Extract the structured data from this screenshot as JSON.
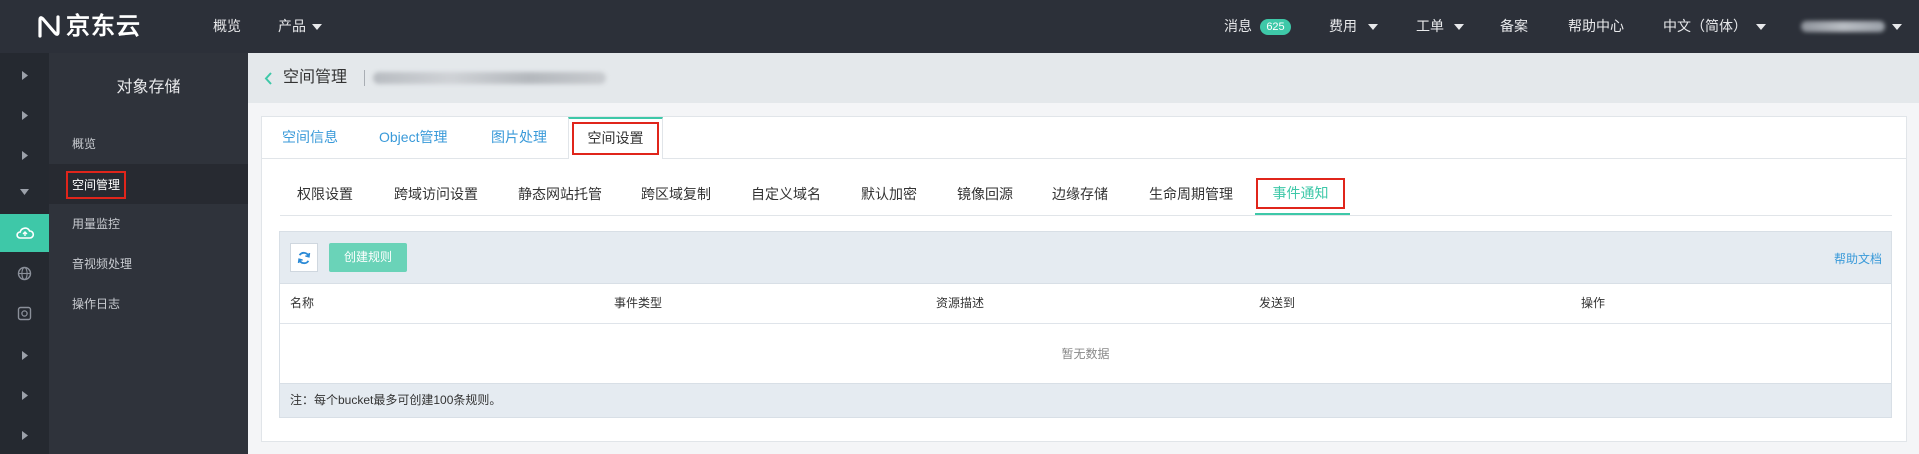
{
  "topnav": {
    "logo_text": "京东云",
    "left_items": [
      {
        "label": "概览"
      },
      {
        "label": "产品"
      }
    ],
    "messages": {
      "label": "消息",
      "count": "625"
    },
    "right_items": [
      {
        "label": "费用"
      },
      {
        "label": "工单"
      },
      {
        "label": "备案"
      },
      {
        "label": "帮助中心"
      },
      {
        "label": "中文（简体）"
      }
    ]
  },
  "rail": {
    "items": [
      {
        "icon": "chevron-right-icon"
      },
      {
        "icon": "chevron-right-icon"
      },
      {
        "icon": "chevron-right-icon"
      },
      {
        "icon": "chevron-down-icon"
      },
      {
        "icon": "cloud-storage-icon",
        "active": true
      },
      {
        "icon": "globe-icon"
      },
      {
        "icon": "container-icon"
      },
      {
        "icon": "chevron-right-icon"
      },
      {
        "icon": "chevron-right-icon"
      },
      {
        "icon": "chevron-right-icon"
      }
    ]
  },
  "sidebar": {
    "title": "对象存储",
    "items": [
      {
        "label": "概览"
      },
      {
        "label": "空间管理",
        "active": true
      },
      {
        "label": "用量监控"
      },
      {
        "label": "音视频处理"
      },
      {
        "label": "操作日志"
      }
    ]
  },
  "header": {
    "title": "空间管理"
  },
  "tabs": {
    "items": [
      "空间信息",
      "Object管理",
      "图片处理",
      "空间设置"
    ],
    "active_index": 3
  },
  "subtabs": {
    "items": [
      "权限设置",
      "跨域访问设置",
      "静态网站托管",
      "跨区域复制",
      "自定义域名",
      "默认加密",
      "镜像回源",
      "边缘存储",
      "生命周期管理",
      "事件通知"
    ],
    "active_index": 9
  },
  "toolbar": {
    "create_label": "创建规则",
    "help_label": "帮助文档"
  },
  "table": {
    "columns": [
      "名称",
      "事件类型",
      "资源描述",
      "发送到",
      "操作"
    ],
    "empty_text": "暂无数据"
  },
  "note": "注：每个bucket最多可创建100条规则。",
  "colors": {
    "accent": "#3ec8a8",
    "link": "#3a9ad9",
    "highlight": "#e0251b",
    "nav_bg": "#2c3039",
    "sidebar_bg": "#2f333b"
  }
}
